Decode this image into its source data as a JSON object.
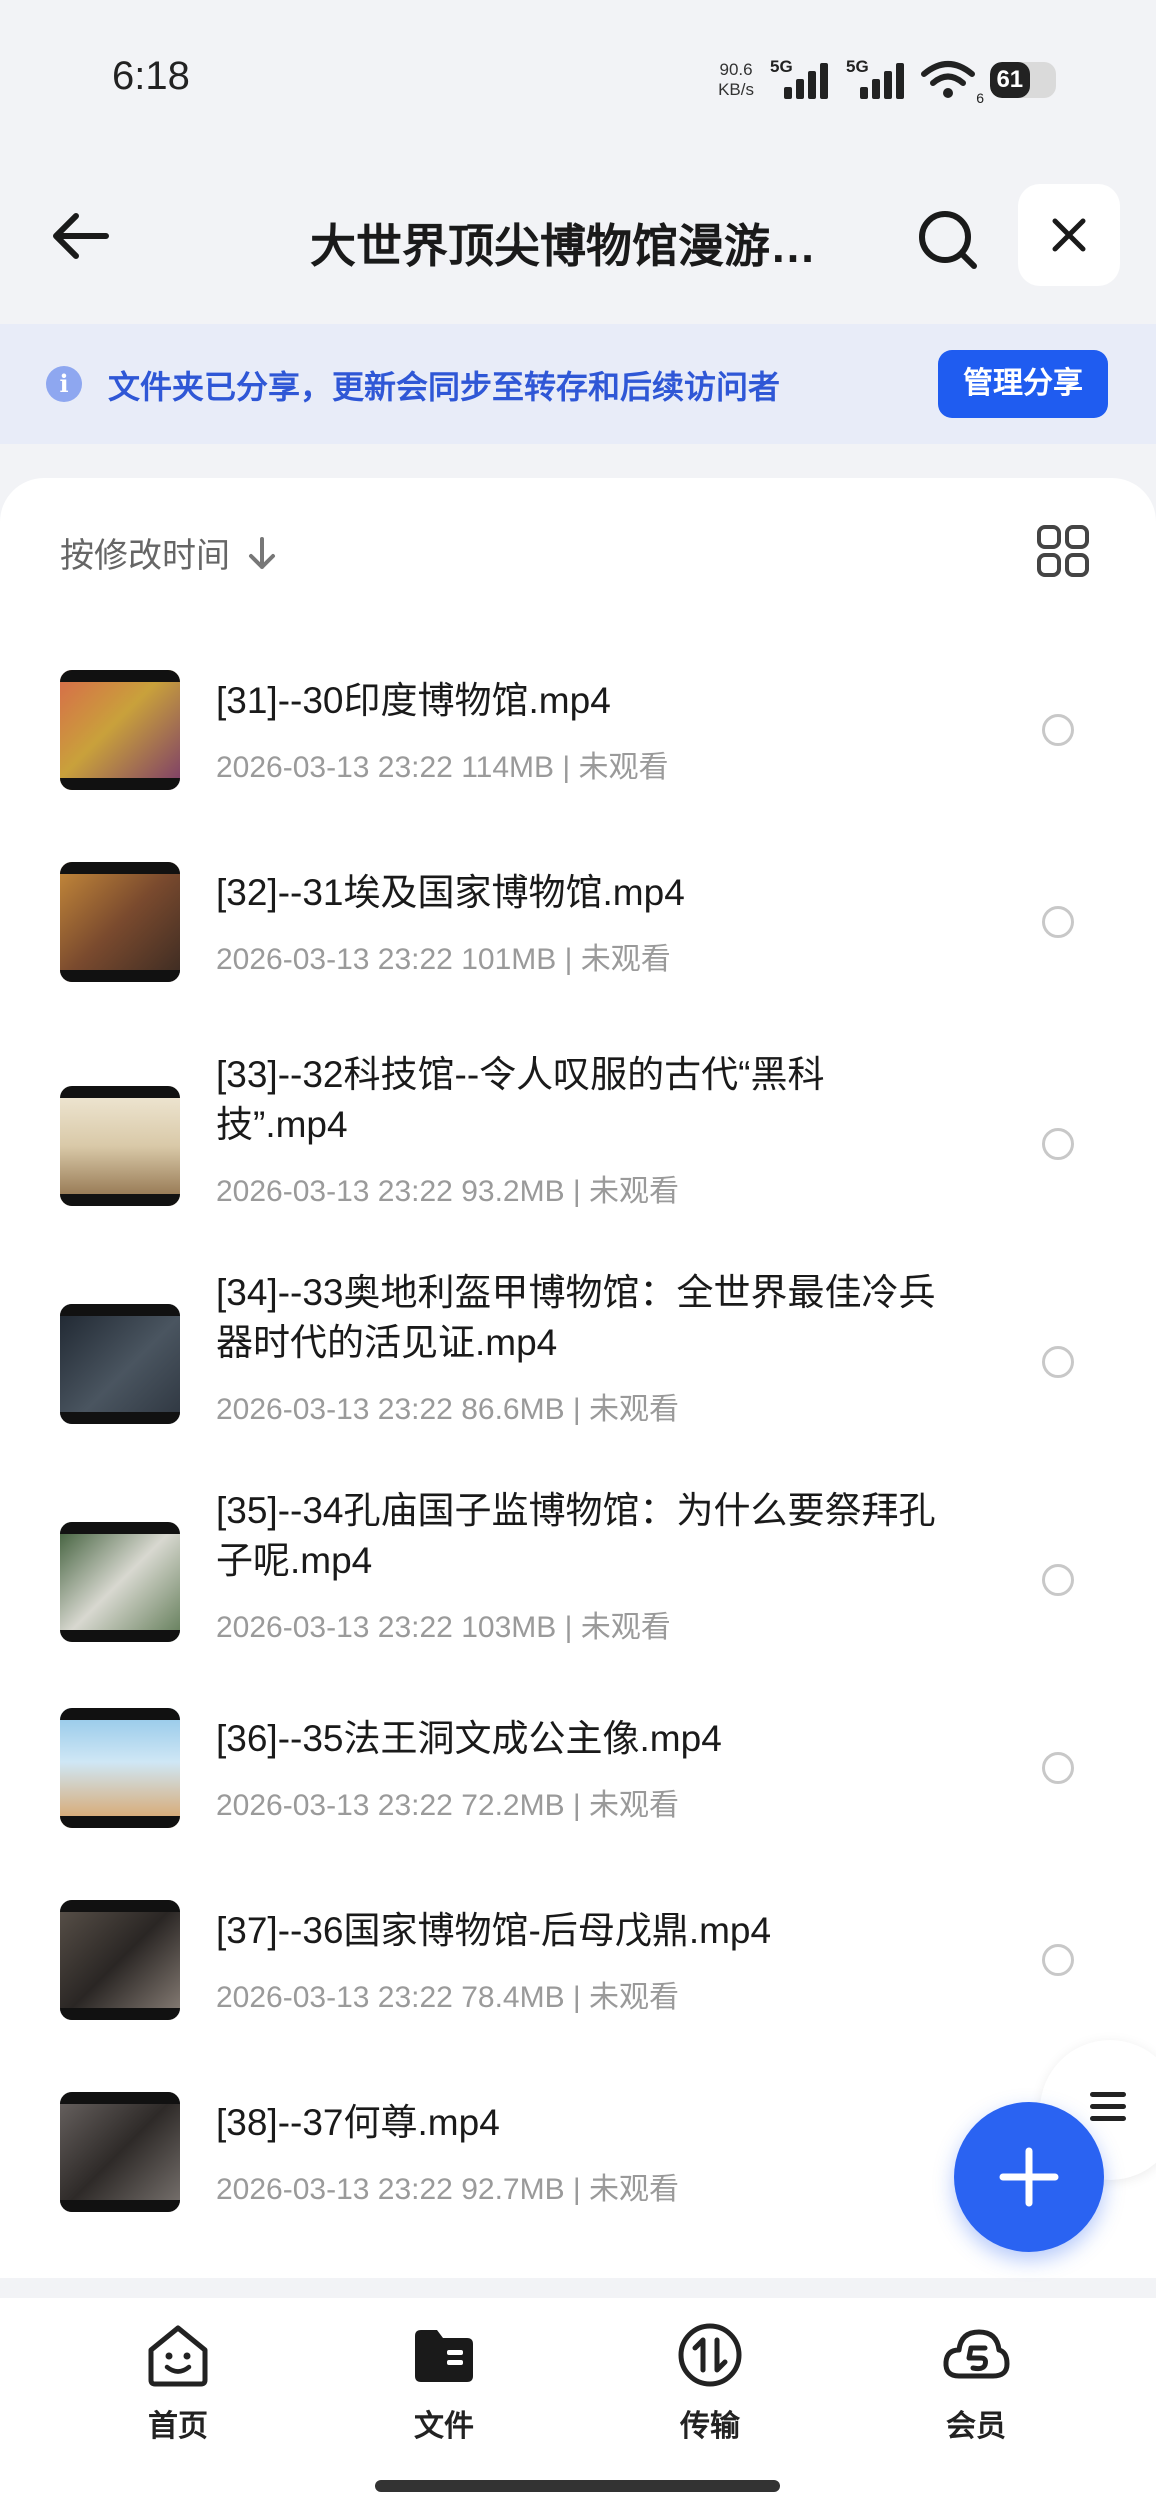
{
  "status_bar": {
    "time": "6:18",
    "net_speed_value": "90.6",
    "net_speed_unit": "KB/s",
    "signal1": "5G",
    "signal2": "5G",
    "wifi_sub": "6",
    "battery": "61"
  },
  "header": {
    "title": "大世界顶尖博物馆漫游…"
  },
  "share_banner": {
    "text": "文件夹已分享，更新会同步至转存和后续访问者",
    "button": "管理分享"
  },
  "sort_bar": {
    "label": "按修改时间"
  },
  "files": [
    {
      "name": "[31]--30印度博物馆.mp4",
      "meta": "2026-03-13 23:22  114MB | 未观看",
      "thumb_color": "#b8594a"
    },
    {
      "name": "[32]--31埃及国家博物馆.mp4",
      "meta": "2026-03-13 23:22  101MB | 未观看",
      "thumb_color": "#7a4a2e"
    },
    {
      "name": "[33]--32科技馆--令人叹服的古代“黑科技”.mp4",
      "meta": "2026-03-13 23:22  93.2MB | 未观看",
      "thumb_color": "#d9c9a8"
    },
    {
      "name": "[34]--33奥地利盔甲博物馆：全世界最佳冷兵器时代的活见证.mp4",
      "meta": "2026-03-13 23:22  86.6MB | 未观看",
      "thumb_color": "#2e3640"
    },
    {
      "name": "[35]--34孔庙国子监博物馆：为什么要祭拜孔子呢.mp4",
      "meta": "2026-03-13 23:22  103MB | 未观看",
      "thumb_color": "#5f7a55"
    },
    {
      "name": "[36]--35法王洞文成公主像.mp4",
      "meta": "2026-03-13 23:22  72.2MB | 未观看",
      "thumb_color": "#8ec5e8"
    },
    {
      "name": "[37]--36国家博物馆-后母戊鼎.mp4",
      "meta": "2026-03-13 23:22  78.4MB | 未观看",
      "thumb_color": "#3b3632"
    },
    {
      "name": "[38]--37何尊.mp4",
      "meta": "2026-03-13 23:22  92.7MB | 未观看",
      "thumb_color": "#4a4644"
    }
  ],
  "bottom_nav": {
    "items": [
      {
        "label": "首页",
        "icon": "home-smile-icon"
      },
      {
        "label": "文件",
        "icon": "folder-icon"
      },
      {
        "label": "传输",
        "icon": "transfer-icon"
      },
      {
        "label": "会员",
        "icon": "vip-cloud-icon"
      }
    ]
  },
  "colors": {
    "accent": "#1f5cf0",
    "banner_bg": "#e8ecf8",
    "banner_text": "#2f57d6"
  }
}
